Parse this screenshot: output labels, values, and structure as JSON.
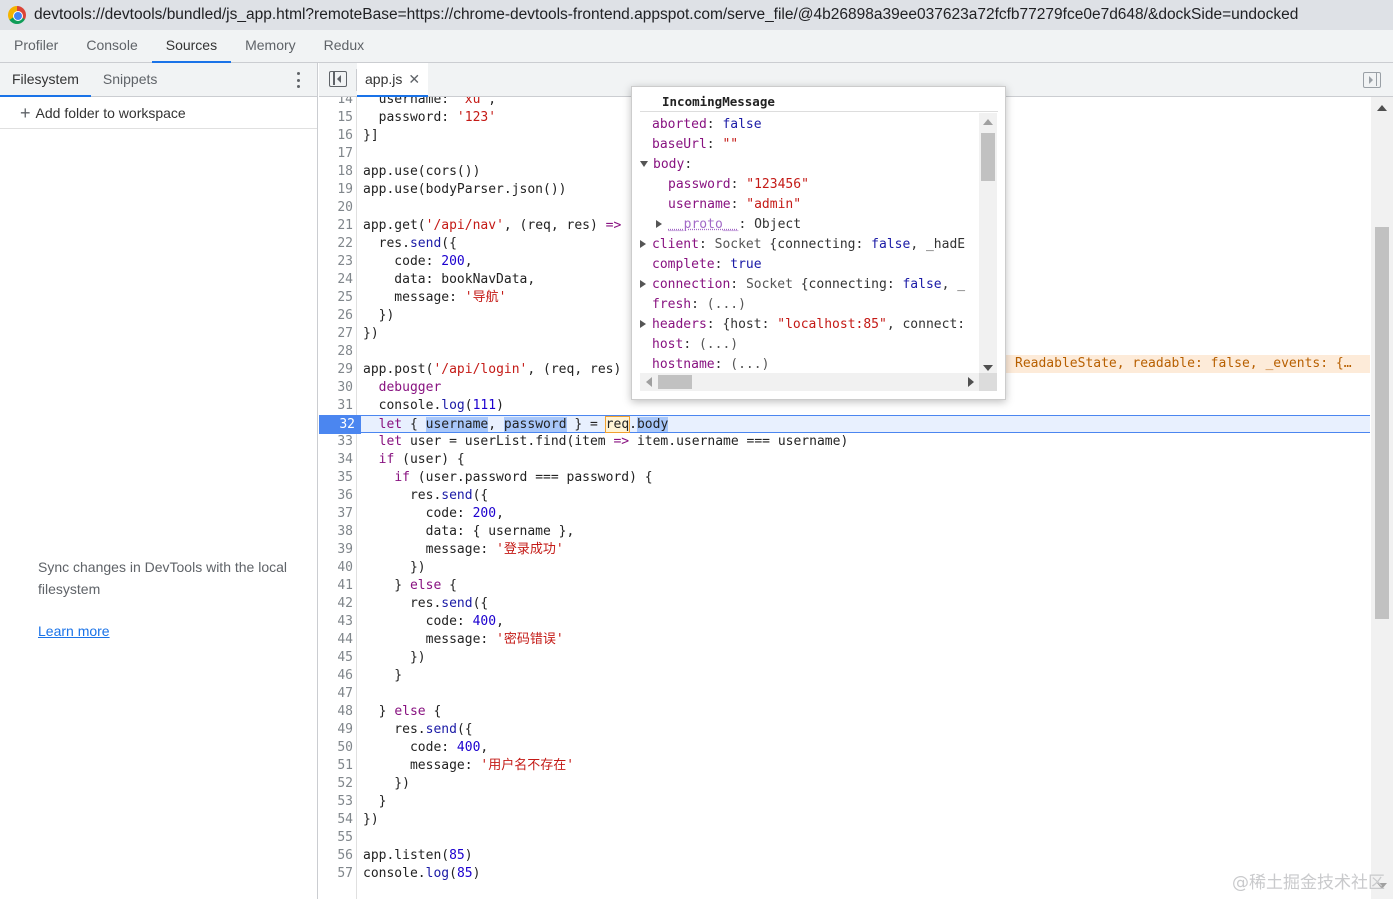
{
  "window": {
    "title": "devtools://devtools/bundled/js_app.html?remoteBase=https://chrome-devtools-frontend.appspot.com/serve_file/@4b26898a39ee037623a72fcfb77279fce0e7d648/&dockSide=undocked"
  },
  "main_tabs": [
    {
      "label": "Profiler"
    },
    {
      "label": "Console"
    },
    {
      "label": "Sources",
      "active": true
    },
    {
      "label": "Memory"
    },
    {
      "label": "Redux"
    }
  ],
  "navigator": {
    "tabs": [
      {
        "label": "Filesystem",
        "active": true
      },
      {
        "label": "Snippets"
      }
    ],
    "add_folder_label": "Add folder to workspace",
    "sync_text": "Sync changes in DevTools with the local filesystem",
    "learn_more": "Learn more"
  },
  "editor": {
    "file_tab": "app.js",
    "inline_preview": "ReadableState, readable: false, _events: {…",
    "lines": [
      {
        "n": "14",
        "t": "  username: 'xu',"
      },
      {
        "n": "15",
        "t": "  password: '123'"
      },
      {
        "n": "16",
        "t": "}]"
      },
      {
        "n": "17",
        "t": ""
      },
      {
        "n": "18",
        "t": "app.use(cors())"
      },
      {
        "n": "19",
        "t": "app.use(bodyParser.json())"
      },
      {
        "n": "20",
        "t": ""
      },
      {
        "n": "21",
        "t": "app.get('/api/nav', (req, res) =>"
      },
      {
        "n": "22",
        "t": "  res.send({"
      },
      {
        "n": "23",
        "t": "    code: 200,"
      },
      {
        "n": "24",
        "t": "    data: bookNavData,"
      },
      {
        "n": "25",
        "t": "    message: '导航'"
      },
      {
        "n": "26",
        "t": "  })"
      },
      {
        "n": "27",
        "t": "})"
      },
      {
        "n": "28",
        "t": ""
      },
      {
        "n": "29",
        "t": "app.post('/api/login', (req, res)"
      },
      {
        "n": "30",
        "t": "  debugger"
      },
      {
        "n": "31",
        "t": "  console.log(111)"
      },
      {
        "n": "32",
        "t": "  let { username, password } = req.body"
      },
      {
        "n": "33",
        "t": "  let user = userList.find(item => item.username === username)"
      },
      {
        "n": "34",
        "t": "  if (user) {"
      },
      {
        "n": "35",
        "t": "    if (user.password === password) {"
      },
      {
        "n": "36",
        "t": "      res.send({"
      },
      {
        "n": "37",
        "t": "        code: 200,"
      },
      {
        "n": "38",
        "t": "        data: { username },"
      },
      {
        "n": "39",
        "t": "        message: '登录成功'"
      },
      {
        "n": "40",
        "t": "      })"
      },
      {
        "n": "41",
        "t": "    } else {"
      },
      {
        "n": "42",
        "t": "      res.send({"
      },
      {
        "n": "43",
        "t": "        code: 400,"
      },
      {
        "n": "44",
        "t": "        message: '密码错误'"
      },
      {
        "n": "45",
        "t": "      })"
      },
      {
        "n": "46",
        "t": "    }"
      },
      {
        "n": "47",
        "t": ""
      },
      {
        "n": "48",
        "t": "  } else {"
      },
      {
        "n": "49",
        "t": "    res.send({"
      },
      {
        "n": "50",
        "t": "      code: 400,"
      },
      {
        "n": "51",
        "t": "      message: '用户名不存在'"
      },
      {
        "n": "52",
        "t": "    })"
      },
      {
        "n": "53",
        "t": "  }"
      },
      {
        "n": "54",
        "t": "})"
      },
      {
        "n": "55",
        "t": ""
      },
      {
        "n": "56",
        "t": "app.listen(85)"
      },
      {
        "n": "57",
        "t": "console.log(85)"
      }
    ],
    "active_line": "32"
  },
  "popover": {
    "title": "IncomingMessage",
    "rows": [
      {
        "indent": 0,
        "expander": "none",
        "key": "aborted",
        "value": "false",
        "vtype": "bool"
      },
      {
        "indent": 0,
        "expander": "none",
        "key": "baseUrl",
        "value": "\"\"",
        "vtype": "str"
      },
      {
        "indent": 0,
        "expander": "down",
        "key": "body",
        "value": "",
        "vtype": "obj"
      },
      {
        "indent": 1,
        "expander": "none",
        "key": "password",
        "value": "\"123456\"",
        "vtype": "str"
      },
      {
        "indent": 1,
        "expander": "none",
        "key": "username",
        "value": "\"admin\"",
        "vtype": "str"
      },
      {
        "indent": 1,
        "expander": "right",
        "key": "__proto__",
        "value": "Object",
        "vtype": "obj",
        "proto": true
      },
      {
        "indent": 0,
        "expander": "right",
        "key": "client",
        "value": "Socket {connecting: false, _hadE",
        "vtype": "obj"
      },
      {
        "indent": 0,
        "expander": "none",
        "key": "complete",
        "value": "true",
        "vtype": "bool"
      },
      {
        "indent": 0,
        "expander": "right",
        "key": "connection",
        "value": "Socket {connecting: false, _",
        "vtype": "obj"
      },
      {
        "indent": 0,
        "expander": "none",
        "key": "fresh",
        "value": "(...)",
        "vtype": "dim"
      },
      {
        "indent": 0,
        "expander": "right",
        "key": "headers",
        "value": "{host: \"localhost:85\", connect:",
        "vtype": "obj"
      },
      {
        "indent": 0,
        "expander": "none",
        "key": "host",
        "value": "(...)",
        "vtype": "dim"
      },
      {
        "indent": 0,
        "expander": "none",
        "key": "hostname",
        "value": "(...)",
        "vtype": "dim"
      }
    ]
  },
  "watermark": "@稀土掘金技术社区",
  "icons": {
    "navigator_more": "kebab-icon",
    "add_folder": "plus-icon",
    "toggle_navigator": "sidebar-toggle-icon",
    "close_tab": "close-icon",
    "toggle_debugger": "debugger-toggle-icon"
  }
}
